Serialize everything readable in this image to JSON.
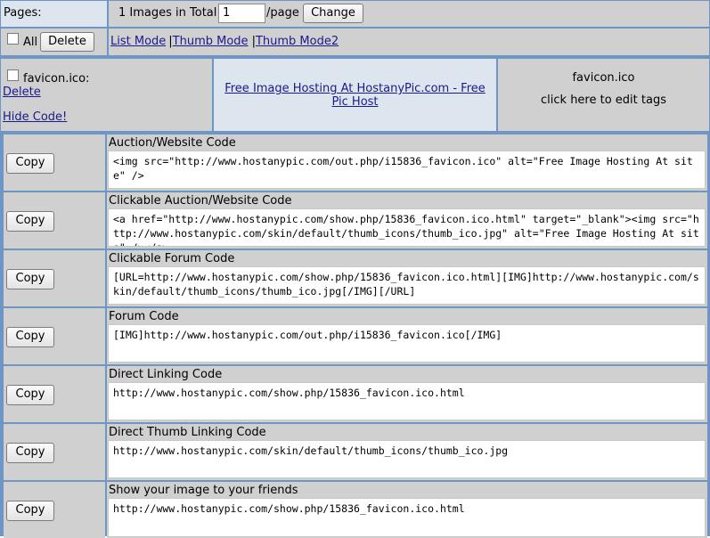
{
  "pager": {
    "label": "Pages:",
    "total_text": "1 Images in Total",
    "per_page_value": "1",
    "per_page_suffix": "/page",
    "change_label": "Change"
  },
  "actions": {
    "all_label": "All",
    "delete_label": "Delete",
    "modes": [
      "List Mode",
      "Thumb Mode",
      "Thumb Mode2"
    ],
    "separator": "|"
  },
  "file": {
    "name": "favicon.ico:",
    "delete_link": "Delete",
    "hide_code_link": "Hide Code!",
    "hosting_link": "Free Image Hosting At HostanyPic.com - Free Pic Host",
    "title": "favicon.ico",
    "edit_tags": "click here to edit tags"
  },
  "copy_label": "Copy",
  "codes": [
    {
      "title": "Auction/Website Code",
      "value": "<img src=\"http://www.hostanypic.com/out.php/i15836_favicon.ico\" alt=\"Free Image Hosting At site\" />"
    },
    {
      "title": "Clickable Auction/Website Code",
      "value": "<a href=\"http://www.hostanypic.com/show.php/15836_favicon.ico.html\" target=\"_blank\"><img src=\"http://www.hostanypic.com/skin/default/thumb_icons/thumb_ico.jpg\" alt=\"Free Image Hosting At site\" /></a>"
    },
    {
      "title": "Clickable Forum Code",
      "value": "[URL=http://www.hostanypic.com/show.php/15836_favicon.ico.html][IMG]http://www.hostanypic.com/skin/default/thumb_icons/thumb_ico.jpg[/IMG][/URL]"
    },
    {
      "title": "Forum Code",
      "value": "[IMG]http://www.hostanypic.com/out.php/i15836_favicon.ico[/IMG]"
    },
    {
      "title": "Direct Linking Code",
      "value": "http://www.hostanypic.com/show.php/15836_favicon.ico.html"
    },
    {
      "title": "Direct Thumb Linking Code",
      "value": "http://www.hostanypic.com/skin/default/thumb_icons/thumb_ico.jpg"
    },
    {
      "title": "Show your image to your friends",
      "value": "http://www.hostanypic.com/show.php/15836_favicon.ico.html"
    }
  ],
  "colors": {
    "border": "#6e95c4",
    "cell": "#d0d0d0",
    "highlight": "#dde6ee",
    "link": "#1a1a8c"
  }
}
